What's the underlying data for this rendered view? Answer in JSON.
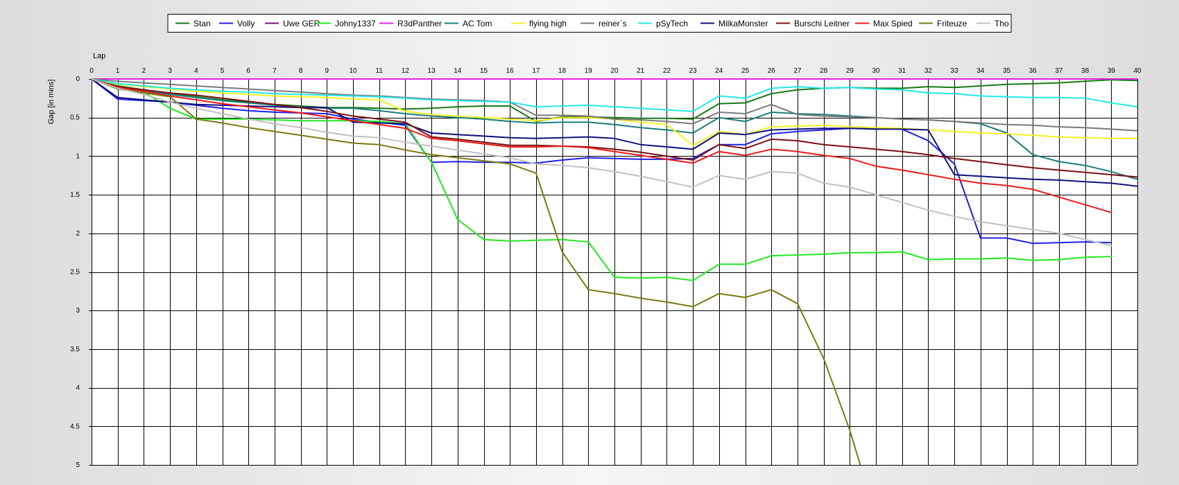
{
  "chart_data": {
    "type": "line",
    "xlabel": "Lap",
    "ylabel": "Gap [in mins]",
    "xlim": [
      0,
      40
    ],
    "ylim": [
      0,
      5
    ],
    "y_inverted": true,
    "grid": true,
    "legend_position": "top",
    "x_ticks": [
      "0",
      "1",
      "2",
      "3",
      "4",
      "5",
      "6",
      "7",
      "8",
      "9",
      "10",
      "11",
      "12",
      "13",
      "14",
      "15",
      "16",
      "17",
      "18",
      "19",
      "20",
      "21",
      "22",
      "23",
      "24",
      "25",
      "26",
      "27",
      "28",
      "29",
      "30",
      "31",
      "32",
      "33",
      "34",
      "35",
      "36",
      "37",
      "38",
      "39",
      "40"
    ],
    "y_ticks": [
      "0",
      "0.5",
      "1",
      "1.5",
      "2",
      "2.5",
      "3",
      "3.5",
      "4",
      "4.5",
      "5"
    ],
    "series": [
      {
        "name": "Stan",
        "color": "#157a15",
        "x": [
          0,
          1,
          2,
          3,
          4,
          5,
          6,
          7,
          8,
          9,
          10,
          11,
          12,
          13,
          14,
          15,
          16,
          17,
          18,
          19,
          20,
          21,
          22,
          23,
          24,
          25,
          26,
          27,
          28,
          29,
          30,
          31,
          32,
          33,
          34,
          35,
          36,
          37,
          38,
          39,
          40
        ],
        "y": [
          0,
          0.09,
          0.14,
          0.19,
          0.23,
          0.27,
          0.3,
          0.33,
          0.35,
          0.37,
          0.37,
          0.38,
          0.39,
          0.38,
          0.36,
          0.35,
          0.35,
          0.55,
          0.49,
          0.49,
          0.5,
          0.51,
          0.51,
          0.52,
          0.32,
          0.31,
          0.19,
          0.14,
          0.12,
          0.11,
          0.12,
          0.12,
          0.1,
          0.11,
          0.09,
          0.07,
          0.06,
          0.05,
          0.03,
          0.01,
          0.02
        ]
      },
      {
        "name": "Volly",
        "color": "#1f1fe8",
        "x": [
          0,
          1,
          2,
          3,
          4,
          5,
          6,
          7,
          8,
          9,
          10,
          11,
          12,
          13,
          14,
          15,
          16,
          17,
          18,
          19,
          20,
          21,
          22,
          23,
          24,
          25,
          26,
          27,
          28,
          29,
          30,
          31,
          32,
          33,
          34,
          35,
          36,
          37,
          38,
          39
        ],
        "y": [
          0,
          0.26,
          0.28,
          0.3,
          0.34,
          0.38,
          0.41,
          0.43,
          0.44,
          0.45,
          0.52,
          0.56,
          0.6,
          1.08,
          1.07,
          1.08,
          1.08,
          1.09,
          1.05,
          1.02,
          1.03,
          1.04,
          1.04,
          1.03,
          0.85,
          0.85,
          0.71,
          0.68,
          0.66,
          0.64,
          0.64,
          0.65,
          0.8,
          1.1,
          2.06,
          2.06,
          2.13,
          2.12,
          2.11,
          2.12
        ]
      },
      {
        "name": "Uwe GER",
        "color": "#7a0d7a",
        "x": [
          0,
          40
        ],
        "y": [
          0,
          0
        ]
      },
      {
        "name": "Johny1337",
        "color": "#22e822",
        "x": [
          0,
          1,
          2,
          3,
          4,
          5,
          6,
          7,
          8,
          9,
          10,
          11,
          12,
          13,
          14,
          15,
          16,
          17,
          18,
          19,
          20,
          21,
          22,
          23,
          24,
          25,
          26,
          27,
          28,
          29,
          30,
          31,
          32,
          33,
          34,
          35,
          36,
          37,
          38,
          39
        ],
        "y": [
          0,
          0.12,
          0.17,
          0.38,
          0.52,
          0.52,
          0.52,
          0.53,
          0.54,
          0.54,
          0.54,
          0.55,
          0.58,
          1.08,
          1.82,
          2.08,
          2.1,
          2.09,
          2.08,
          2.11,
          2.57,
          2.58,
          2.57,
          2.61,
          2.4,
          2.4,
          2.29,
          2.28,
          2.27,
          2.25,
          2.25,
          2.24,
          2.34,
          2.33,
          2.33,
          2.32,
          2.35,
          2.34,
          2.31,
          2.3
        ]
      },
      {
        "name": "R3dPanther",
        "color": "#e81ee8",
        "x": [
          0,
          40
        ],
        "y": [
          0,
          0
        ]
      },
      {
        "name": "AC Tom",
        "color": "#1a7c7c",
        "x": [
          0,
          1,
          2,
          3,
          4,
          5,
          6,
          7,
          8,
          9,
          10,
          11,
          12,
          13,
          14,
          15,
          16,
          17,
          18,
          19,
          20,
          21,
          22,
          23,
          24,
          25,
          26,
          27,
          28,
          29,
          30,
          31,
          32,
          33,
          34,
          35,
          36,
          37,
          38,
          39,
          40
        ],
        "y": [
          0,
          0.1,
          0.15,
          0.2,
          0.24,
          0.28,
          0.31,
          0.34,
          0.36,
          0.38,
          0.38,
          0.41,
          0.45,
          0.48,
          0.5,
          0.52,
          0.55,
          0.57,
          0.56,
          0.56,
          0.59,
          0.63,
          0.66,
          0.7,
          0.5,
          0.55,
          0.43,
          0.45,
          0.46,
          0.48,
          0.5,
          0.52,
          0.53,
          0.55,
          0.58,
          0.7,
          0.98,
          1.07,
          1.12,
          1.2,
          1.3
        ]
      },
      {
        "name": "flying high",
        "color": "#f2f222",
        "x": [
          0,
          1,
          2,
          3,
          4,
          5,
          6,
          7,
          8,
          9,
          10,
          11,
          12,
          13,
          14,
          15,
          16,
          17,
          18,
          19,
          20,
          21,
          22,
          23,
          24,
          25,
          26,
          27,
          28,
          29,
          30,
          31,
          32,
          33,
          34,
          35,
          36,
          37,
          38,
          39,
          40
        ],
        "y": [
          0,
          0.07,
          0.1,
          0.13,
          0.16,
          0.18,
          0.2,
          0.22,
          0.23,
          0.24,
          0.26,
          0.27,
          0.42,
          0.46,
          0.48,
          0.5,
          0.52,
          0.54,
          0.5,
          0.5,
          0.52,
          0.56,
          0.59,
          0.86,
          0.68,
          0.72,
          0.62,
          0.61,
          0.6,
          0.62,
          0.63,
          0.64,
          0.66,
          0.68,
          0.7,
          0.71,
          0.73,
          0.75,
          0.76,
          0.77,
          0.77
        ]
      },
      {
        "name": "reiner`s",
        "color": "#7a7a7a",
        "x": [
          0,
          1,
          2,
          3,
          4,
          5,
          6,
          7,
          8,
          9,
          10,
          11,
          12,
          13,
          14,
          15,
          16,
          17,
          18,
          19,
          20,
          21,
          22,
          23,
          24,
          25,
          26,
          27,
          28,
          29,
          30,
          31,
          32,
          33,
          34,
          35,
          36,
          37,
          38,
          39,
          40
        ],
        "y": [
          0,
          0.03,
          0.05,
          0.07,
          0.09,
          0.11,
          0.13,
          0.15,
          0.17,
          0.19,
          0.21,
          0.22,
          0.24,
          0.26,
          0.27,
          0.28,
          0.3,
          0.47,
          0.47,
          0.48,
          0.52,
          0.53,
          0.55,
          0.58,
          0.43,
          0.45,
          0.33,
          0.46,
          0.48,
          0.49,
          0.5,
          0.52,
          0.53,
          0.55,
          0.57,
          0.59,
          0.6,
          0.62,
          0.63,
          0.65,
          0.67
        ]
      },
      {
        "name": "pSyTech",
        "color": "#22e8e8",
        "x": [
          0,
          1,
          2,
          3,
          4,
          5,
          6,
          7,
          8,
          9,
          10,
          11,
          12,
          13,
          14,
          15,
          16,
          17,
          18,
          19,
          20,
          21,
          22,
          23,
          24,
          25,
          26,
          27,
          28,
          29,
          30,
          31,
          32,
          33,
          34,
          35,
          36,
          37,
          38,
          39,
          40
        ],
        "y": [
          0,
          0.06,
          0.09,
          0.12,
          0.14,
          0.16,
          0.17,
          0.19,
          0.2,
          0.21,
          0.22,
          0.23,
          0.25,
          0.27,
          0.28,
          0.29,
          0.3,
          0.36,
          0.35,
          0.34,
          0.36,
          0.38,
          0.4,
          0.42,
          0.22,
          0.25,
          0.12,
          0.1,
          0.12,
          0.11,
          0.13,
          0.14,
          0.18,
          0.19,
          0.22,
          0.23,
          0.24,
          0.24,
          0.25,
          0.31,
          0.36
        ]
      },
      {
        "name": "MilkaMonster",
        "color": "#10107a",
        "x": [
          0,
          1,
          2,
          3,
          4,
          5,
          6,
          7,
          8,
          9,
          10,
          11,
          12,
          13,
          14,
          15,
          16,
          17,
          18,
          19,
          20,
          21,
          22,
          23,
          24,
          25,
          26,
          27,
          28,
          29,
          30,
          31,
          32,
          33,
          34,
          35,
          36,
          37,
          38,
          39,
          40
        ],
        "y": [
          0,
          0.24,
          0.27,
          0.3,
          0.33,
          0.34,
          0.35,
          0.36,
          0.37,
          0.37,
          0.56,
          0.57,
          0.58,
          0.7,
          0.72,
          0.74,
          0.76,
          0.77,
          0.76,
          0.75,
          0.77,
          0.85,
          0.88,
          0.91,
          0.7,
          0.72,
          0.66,
          0.65,
          0.64,
          0.64,
          0.65,
          0.65,
          0.66,
          1.24,
          1.26,
          1.28,
          1.3,
          1.31,
          1.33,
          1.35,
          1.39
        ]
      },
      {
        "name": "Burschi Leitner",
        "color": "#7a1010",
        "x": [
          0,
          1,
          2,
          3,
          4,
          5,
          6,
          7,
          8,
          9,
          10,
          11,
          12,
          13,
          14,
          15,
          16,
          17,
          18,
          19,
          20,
          21,
          22,
          23,
          24,
          25,
          26,
          27,
          28,
          29,
          30,
          31,
          32,
          33,
          34,
          35,
          36,
          37,
          38,
          39,
          40
        ],
        "y": [
          0,
          0.1,
          0.14,
          0.18,
          0.21,
          0.25,
          0.29,
          0.33,
          0.37,
          0.42,
          0.48,
          0.52,
          0.56,
          0.75,
          0.78,
          0.82,
          0.86,
          0.86,
          0.87,
          0.88,
          0.91,
          0.95,
          1.0,
          1.05,
          0.85,
          0.9,
          0.78,
          0.8,
          0.85,
          0.88,
          0.91,
          0.94,
          0.98,
          1.03,
          1.07,
          1.11,
          1.15,
          1.18,
          1.21,
          1.24,
          1.27
        ]
      },
      {
        "name": "Max Spied",
        "color": "#ee1a1a",
        "x": [
          0,
          1,
          2,
          3,
          4,
          5,
          6,
          7,
          8,
          9,
          10,
          11,
          12,
          13,
          14,
          15,
          16,
          17,
          18,
          19,
          20,
          21,
          22,
          23,
          24,
          25,
          26,
          27,
          28,
          29,
          30,
          31,
          32,
          33,
          34,
          35,
          36,
          37,
          38,
          39
        ],
        "y": [
          0,
          0.11,
          0.16,
          0.22,
          0.27,
          0.32,
          0.36,
          0.4,
          0.44,
          0.49,
          0.54,
          0.59,
          0.64,
          0.77,
          0.8,
          0.84,
          0.88,
          0.88,
          0.87,
          0.89,
          0.94,
          0.99,
          1.04,
          1.09,
          0.94,
          0.99,
          0.91,
          0.94,
          0.99,
          1.03,
          1.13,
          1.18,
          1.24,
          1.3,
          1.35,
          1.38,
          1.43,
          1.53,
          1.63,
          1.73
        ]
      },
      {
        "name": "Friteuze",
        "color": "#7a7a10",
        "x": [
          0,
          1,
          2,
          3,
          4,
          5,
          6,
          7,
          8,
          9,
          10,
          11,
          12,
          13,
          14,
          15,
          16,
          17,
          18,
          19,
          20,
          21,
          22,
          23,
          24,
          25,
          26,
          27,
          28,
          29,
          29.4
        ],
        "y": [
          0,
          0.13,
          0.18,
          0.23,
          0.52,
          0.57,
          0.63,
          0.68,
          0.73,
          0.78,
          0.83,
          0.85,
          0.92,
          0.98,
          1.02,
          1.06,
          1.1,
          1.22,
          2.24,
          2.73,
          2.78,
          2.84,
          2.89,
          2.95,
          2.78,
          2.83,
          2.73,
          2.91,
          3.62,
          4.55,
          5.0
        ]
      },
      {
        "name": "Tho",
        "color": "#c0c0c0",
        "x": [
          0,
          1,
          2,
          3,
          4,
          5,
          6,
          7,
          8,
          9,
          10,
          11,
          12,
          13,
          14,
          15,
          16,
          17,
          18,
          19,
          20,
          21,
          22,
          23,
          24,
          25,
          26,
          27,
          28,
          29,
          30,
          31,
          32,
          33,
          34,
          35,
          36,
          37,
          38,
          39
        ],
        "y": [
          0,
          0.12,
          0.2,
          0.3,
          0.38,
          0.45,
          0.52,
          0.58,
          0.63,
          0.69,
          0.74,
          0.76,
          0.82,
          0.87,
          0.92,
          0.97,
          1.02,
          1.1,
          1.12,
          1.15,
          1.2,
          1.26,
          1.33,
          1.4,
          1.25,
          1.3,
          1.2,
          1.22,
          1.35,
          1.4,
          1.5,
          1.6,
          1.7,
          1.78,
          1.85,
          1.9,
          1.95,
          2.0,
          2.08,
          2.16
        ]
      }
    ]
  }
}
